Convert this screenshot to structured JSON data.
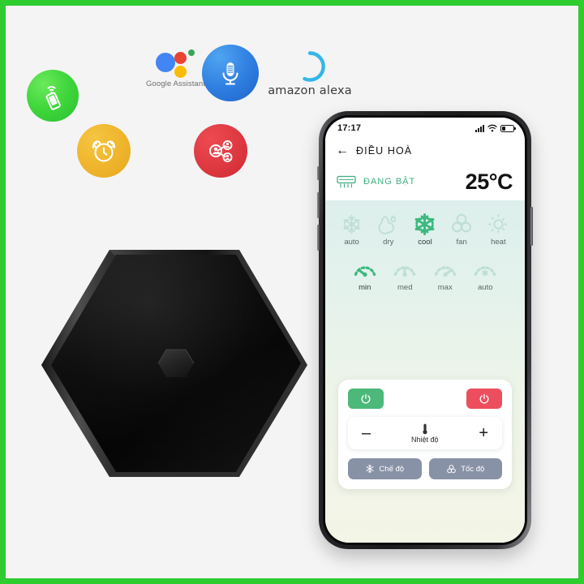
{
  "theme": {
    "border_green": "#2ECC2E",
    "canvas": "#F4F4F4",
    "accent_green": "#3FAE82",
    "power_on_green": "#4CB87A",
    "power_off_red": "#ED4E5E",
    "option_slate": "#8892A6",
    "screen_cream": "#F2F4E8"
  },
  "badges": [
    {
      "name": "smart-phone-wifi-icon",
      "label": "",
      "color": "#3FD63B"
    },
    {
      "name": "alarm-clock-icon",
      "label": "",
      "color": "#EFB52C"
    },
    {
      "name": "share-users-icon",
      "label": "",
      "color": "#DE3840"
    },
    {
      "name": "voice-microphone-icon",
      "label": "",
      "color": "#2E7DE0"
    }
  ],
  "assistants": {
    "google": {
      "label": "Google Assistant",
      "icon": "google-assistant-dots-icon"
    },
    "alexa": {
      "label": "amazon alexa",
      "icon": "alexa-ring-icon"
    }
  },
  "device": {
    "name": "hexagon-ir-hub",
    "body_color": "#0B0B0B",
    "button_color": "#2A2A2A"
  },
  "phone": {
    "statusbar": {
      "clock": "17:17",
      "signal_icon": "cellular-bars-icon",
      "wifi_icon": "wifi-icon",
      "battery_icon": "battery-icon"
    },
    "appbar": {
      "back_icon": "back-arrow-icon",
      "title": "ĐIỀU HOÀ"
    },
    "status_strip": {
      "device_icon": "air-conditioner-icon",
      "state_label": "ĐANG BẬT",
      "temperature": "25°C"
    },
    "mode_row": [
      {
        "label": "auto",
        "icon": "snowflake-auto-icon",
        "active": false
      },
      {
        "label": "dry",
        "icon": "water-drop-icon",
        "active": false
      },
      {
        "label": "cool",
        "icon": "snowflake-icon",
        "active": true
      },
      {
        "label": "fan",
        "icon": "fan-blades-icon",
        "active": false
      },
      {
        "label": "heat",
        "icon": "sun-icon",
        "active": false
      }
    ],
    "speed_row": [
      {
        "label": "min",
        "icon": "gauge-min-icon",
        "active": true
      },
      {
        "label": "med",
        "icon": "gauge-med-icon",
        "active": false
      },
      {
        "label": "max",
        "icon": "gauge-max-icon",
        "active": false
      },
      {
        "label": "auto",
        "icon": "gauge-auto-icon",
        "active": false
      }
    ],
    "controls": {
      "power_on": {
        "label": "",
        "icon": "power-icon"
      },
      "power_off": {
        "label": "",
        "icon": "power-icon"
      },
      "temp": {
        "minus_label": "–",
        "plus_label": "+",
        "label": "Nhiệt độ",
        "icon": "thermometer-icon"
      },
      "options": [
        {
          "label": "Chế độ",
          "icon": "snowflake-small-icon"
        },
        {
          "label": "Tốc độ",
          "icon": "fan-small-icon"
        }
      ]
    }
  }
}
